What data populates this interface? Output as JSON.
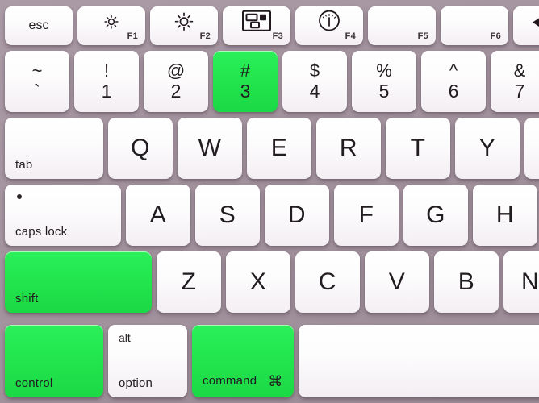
{
  "keyboard": {
    "layout": "apple-mac-partial",
    "background_color": "#a4949f",
    "key_color": "#fdfbfc",
    "highlight_color": "#23e64e",
    "text_color": "#211c1f",
    "highlighted_keys": [
      "3",
      "shift",
      "control",
      "command"
    ]
  },
  "rows": {
    "function_row": [
      {
        "name": "esc",
        "label": "esc",
        "fn": "",
        "icon": "",
        "highlight": false
      },
      {
        "name": "f1",
        "label": "",
        "fn": "F1",
        "icon": "brightness-down-icon",
        "highlight": false
      },
      {
        "name": "f2",
        "label": "",
        "fn": "F2",
        "icon": "brightness-up-icon",
        "highlight": false
      },
      {
        "name": "f3",
        "label": "",
        "fn": "F3",
        "icon": "mission-control-icon",
        "highlight": false
      },
      {
        "name": "f4",
        "label": "",
        "fn": "F4",
        "icon": "dashboard-gauge-icon",
        "highlight": false
      },
      {
        "name": "f5",
        "label": "",
        "fn": "F5",
        "icon": "",
        "highlight": false
      },
      {
        "name": "f6",
        "label": "",
        "fn": "F6",
        "icon": "",
        "highlight": false
      },
      {
        "name": "f7",
        "label": "",
        "fn": "",
        "icon": "rewind-icon",
        "highlight": false
      }
    ],
    "number_row": [
      {
        "name": "tilde",
        "top": "~",
        "bottom": "`",
        "highlight": false
      },
      {
        "name": "one",
        "top": "!",
        "bottom": "1",
        "highlight": false
      },
      {
        "name": "two",
        "top": "@",
        "bottom": "2",
        "highlight": false
      },
      {
        "name": "three",
        "top": "#",
        "bottom": "3",
        "highlight": true
      },
      {
        "name": "four",
        "top": "$",
        "bottom": "4",
        "highlight": false
      },
      {
        "name": "five",
        "top": "%",
        "bottom": "5",
        "highlight": false
      },
      {
        "name": "six",
        "top": "^",
        "bottom": "6",
        "highlight": false
      },
      {
        "name": "seven",
        "top": "&",
        "bottom": "7",
        "highlight": false
      }
    ],
    "top_letter_row": [
      {
        "name": "tab",
        "label": "tab",
        "highlight": false
      },
      {
        "name": "q",
        "label": "Q",
        "highlight": false
      },
      {
        "name": "w",
        "label": "W",
        "highlight": false
      },
      {
        "name": "e",
        "label": "E",
        "highlight": false
      },
      {
        "name": "r",
        "label": "R",
        "highlight": false
      },
      {
        "name": "t",
        "label": "T",
        "highlight": false
      },
      {
        "name": "y",
        "label": "Y",
        "highlight": false
      },
      {
        "name": "u",
        "label": "",
        "highlight": false
      }
    ],
    "home_row": [
      {
        "name": "caps-lock",
        "label": "caps lock",
        "highlight": false
      },
      {
        "name": "a",
        "label": "A",
        "highlight": false
      },
      {
        "name": "s",
        "label": "S",
        "highlight": false
      },
      {
        "name": "d",
        "label": "D",
        "highlight": false
      },
      {
        "name": "f",
        "label": "F",
        "highlight": false
      },
      {
        "name": "g",
        "label": "G",
        "highlight": false
      },
      {
        "name": "h",
        "label": "H",
        "highlight": false
      }
    ],
    "bottom_letter_row": [
      {
        "name": "shift",
        "label": "shift",
        "highlight": true
      },
      {
        "name": "z",
        "label": "Z",
        "highlight": false
      },
      {
        "name": "x",
        "label": "X",
        "highlight": false
      },
      {
        "name": "c",
        "label": "C",
        "highlight": false
      },
      {
        "name": "v",
        "label": "V",
        "highlight": false
      },
      {
        "name": "b",
        "label": "B",
        "highlight": false
      },
      {
        "name": "n",
        "label": "N",
        "highlight": false
      }
    ],
    "modifier_row": [
      {
        "name": "control",
        "label": "control",
        "alt_label": "",
        "symbol": "",
        "highlight": true
      },
      {
        "name": "option",
        "label": "option",
        "alt_label": "alt",
        "symbol": "",
        "highlight": false
      },
      {
        "name": "command",
        "label": "command",
        "alt_label": "",
        "symbol": "⌘",
        "highlight": true
      },
      {
        "name": "space",
        "label": "",
        "alt_label": "",
        "symbol": "",
        "highlight": false
      }
    ]
  }
}
